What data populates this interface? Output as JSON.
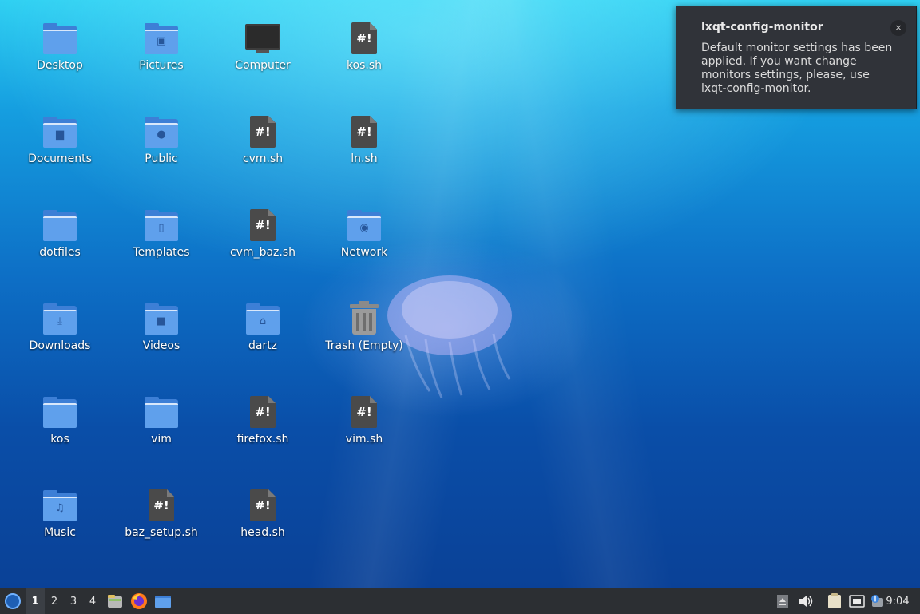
{
  "desktop": {
    "icons": [
      {
        "label": "Desktop",
        "kind": "folder",
        "emblem": ""
      },
      {
        "label": "Documents",
        "kind": "folder",
        "emblem": "document"
      },
      {
        "label": "dotfiles",
        "kind": "folder",
        "emblem": ""
      },
      {
        "label": "Downloads",
        "kind": "folder",
        "emblem": "download"
      },
      {
        "label": "kos",
        "kind": "folder",
        "emblem": ""
      },
      {
        "label": "Music",
        "kind": "folder",
        "emblem": "music"
      },
      {
        "label": "Pictures",
        "kind": "folder",
        "emblem": "image"
      },
      {
        "label": "Public",
        "kind": "folder",
        "emblem": "user"
      },
      {
        "label": "Templates",
        "kind": "folder",
        "emblem": "template"
      },
      {
        "label": "Videos",
        "kind": "folder",
        "emblem": "video"
      },
      {
        "label": "vim",
        "kind": "folder",
        "emblem": ""
      },
      {
        "label": "baz_setup.sh",
        "kind": "script"
      },
      {
        "label": "Computer",
        "kind": "computer"
      },
      {
        "label": "cvm.sh",
        "kind": "script"
      },
      {
        "label": "cvm_baz.sh",
        "kind": "script"
      },
      {
        "label": "dartz",
        "kind": "folder",
        "emblem": "home"
      },
      {
        "label": "firefox.sh",
        "kind": "script"
      },
      {
        "label": "head.sh",
        "kind": "script"
      },
      {
        "label": "kos.sh",
        "kind": "script"
      },
      {
        "label": "ln.sh",
        "kind": "script"
      },
      {
        "label": "Network",
        "kind": "folder",
        "emblem": "network"
      },
      {
        "label": "Trash (Empty)",
        "kind": "trash"
      },
      {
        "label": "vim.sh",
        "kind": "script"
      }
    ]
  },
  "notification": {
    "title": "lxqt-config-monitor",
    "body": "Default monitor settings has been applied. If you want change monitors settings, please, use lxqt-config-monitor.",
    "close_glyph": "×"
  },
  "taskbar": {
    "workspaces": [
      "1",
      "2",
      "3",
      "4"
    ],
    "active_workspace": "1",
    "quicklaunch": [
      "file-manager-icon",
      "firefox-icon",
      "folder-icon"
    ],
    "tray": [
      "eject-icon",
      "volume-icon",
      "clipboard-icon",
      "network-icon",
      "notification-icon"
    ],
    "clock": "9:04"
  },
  "script_glyph": "#!"
}
